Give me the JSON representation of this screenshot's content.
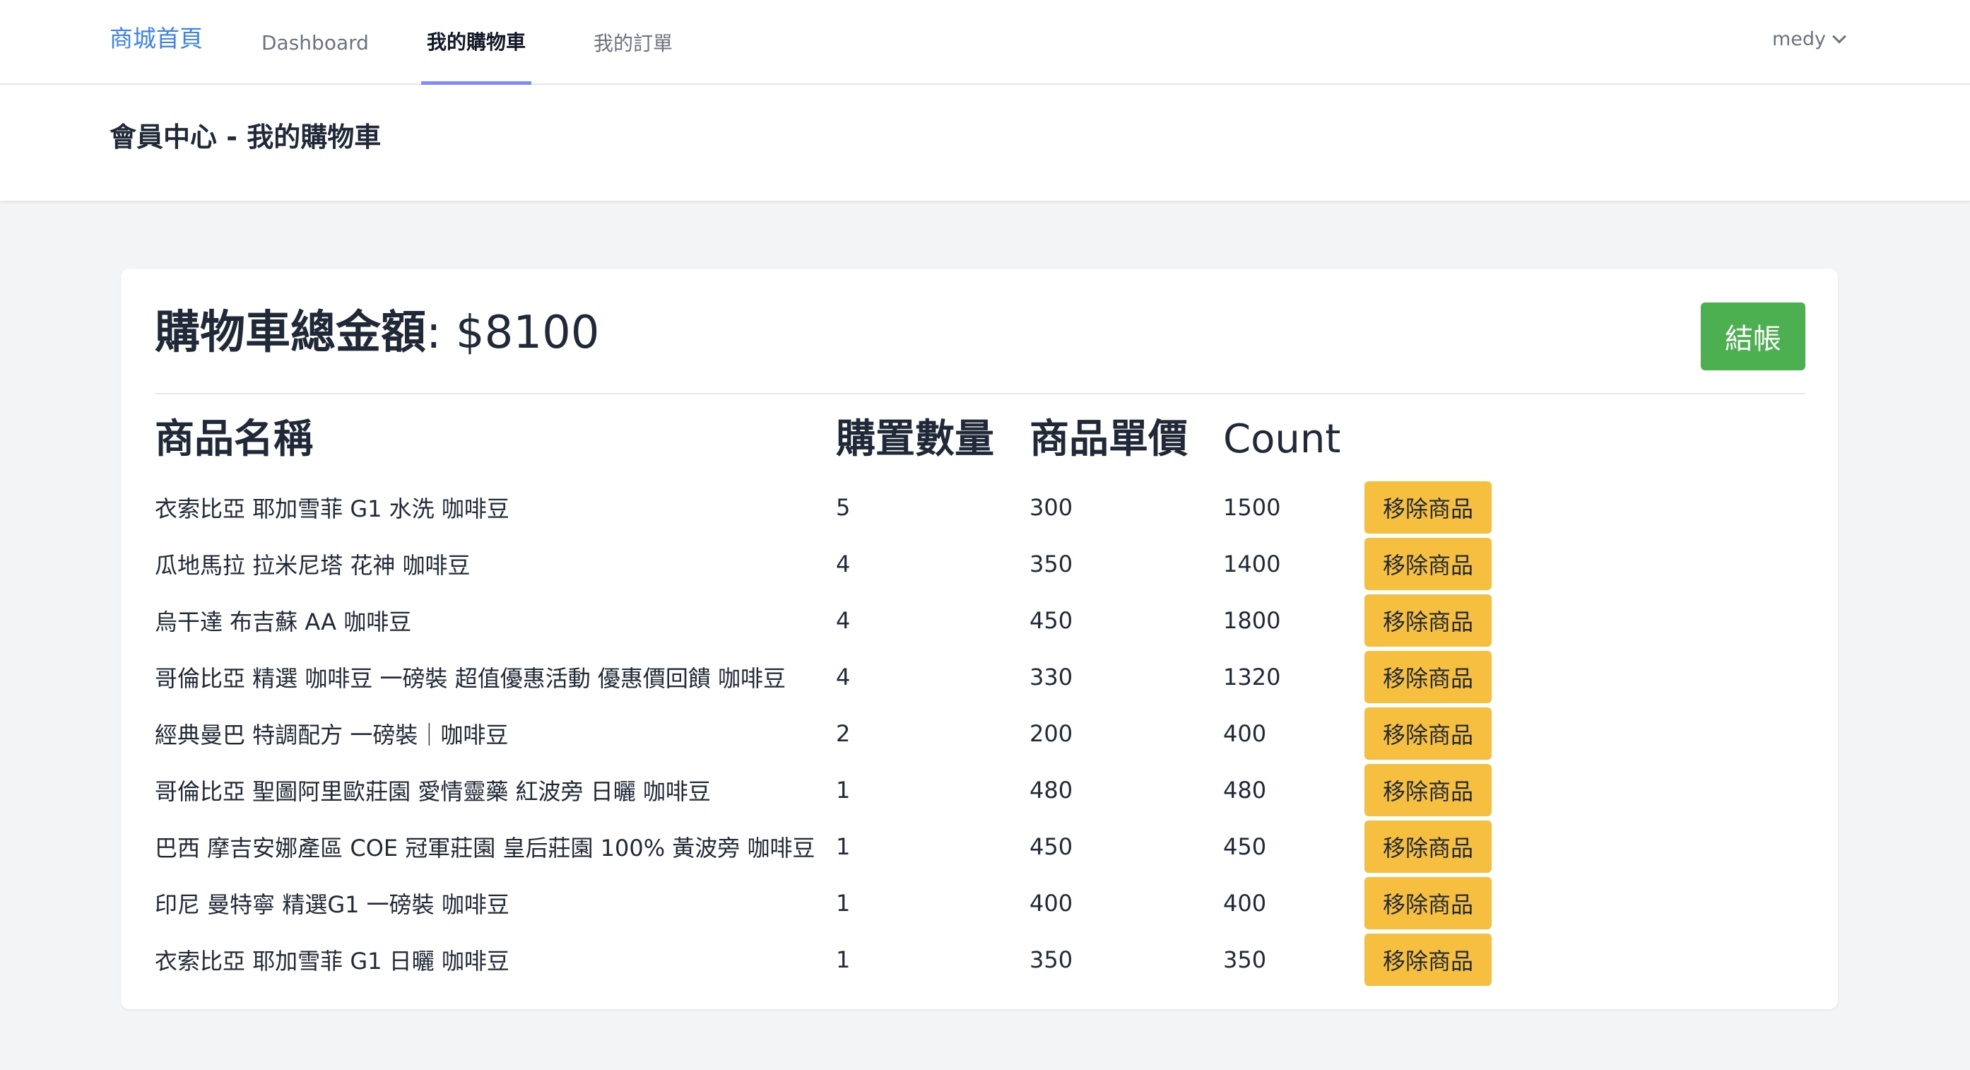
{
  "nav": {
    "brand": "商城首頁",
    "links": [
      {
        "label": "Dashboard"
      },
      {
        "label": "我的購物車"
      },
      {
        "label": "我的訂單"
      }
    ],
    "user": "medy"
  },
  "header": {
    "title": "會員中心 - 我的購物車"
  },
  "cart": {
    "total_label": "購物車總金額",
    "total_value": ": $8100",
    "checkout_label": "結帳",
    "columns": {
      "name": "商品名稱",
      "qty": "購置數量",
      "price": "商品單價",
      "count": "Count"
    },
    "remove_label": "移除商品",
    "items": [
      {
        "name": "衣索比亞 耶加雪菲 G1 水洗 咖啡豆",
        "qty": "5",
        "price": "300",
        "count": "1500"
      },
      {
        "name": "瓜地馬拉 拉米尼塔 花神 咖啡豆",
        "qty": "4",
        "price": "350",
        "count": "1400"
      },
      {
        "name": "烏干達 布吉蘇 AA 咖啡豆",
        "qty": "4",
        "price": "450",
        "count": "1800"
      },
      {
        "name": "哥倫比亞 精選 咖啡豆 一磅裝 超值優惠活動 優惠價回饋 咖啡豆",
        "qty": "4",
        "price": "330",
        "count": "1320"
      },
      {
        "name": "經典曼巴 特調配方 一磅裝｜咖啡豆",
        "qty": "2",
        "price": "200",
        "count": "400"
      },
      {
        "name": "哥倫比亞 聖圖阿里歐莊園 愛情靈藥 紅波旁 日曬 咖啡豆",
        "qty": "1",
        "price": "480",
        "count": "480"
      },
      {
        "name": "巴西 摩吉安娜產區 COE 冠軍莊園 皇后莊園 100% 黃波旁 咖啡豆",
        "qty": "1",
        "price": "450",
        "count": "450"
      },
      {
        "name": "印尼 曼特寧 精選G1 一磅裝 咖啡豆",
        "qty": "1",
        "price": "400",
        "count": "400"
      },
      {
        "name": "衣索比亞 耶加雪菲 G1 日曬 咖啡豆",
        "qty": "1",
        "price": "350",
        "count": "350"
      }
    ]
  },
  "colors": {
    "brand": "#3b82f6",
    "active_tab_underline": "#818cf8",
    "checkout_button": "#4caf50",
    "remove_button": "#f6bf40",
    "page_background": "#f3f4f6"
  },
  "icons": {
    "user_menu": "chevron-down-icon"
  }
}
